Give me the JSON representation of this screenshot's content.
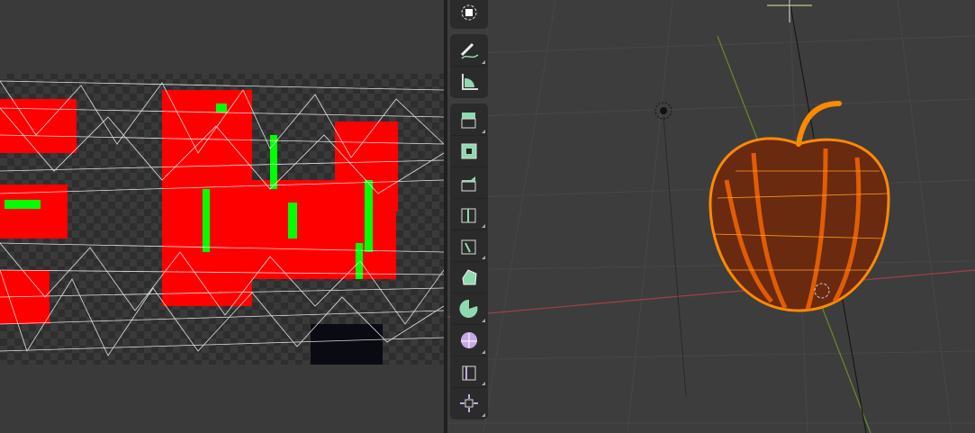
{
  "editors": {
    "left": "uv-editor",
    "right": "3d-viewport"
  },
  "colors": {
    "accent_selection": "#ff8a00",
    "axis_x": "#a0404a",
    "axis_y": "#6b8a2a",
    "tool_green": "#8fd9b0",
    "tool_purple": "#c7a8e6"
  },
  "toolbar": {
    "tools": [
      {
        "name": "transform",
        "icon": "transform-icon"
      },
      {
        "name": "annotate",
        "icon": "annotate-icon"
      },
      {
        "name": "measure",
        "icon": "measure-icon"
      },
      {
        "name": "extrude-region",
        "icon": "extrude-region-icon"
      },
      {
        "name": "inset-faces",
        "icon": "inset-faces-icon"
      },
      {
        "name": "bevel",
        "icon": "bevel-icon"
      },
      {
        "name": "loop-cut",
        "icon": "loop-cut-icon"
      },
      {
        "name": "knife",
        "icon": "knife-icon"
      },
      {
        "name": "poly-build",
        "icon": "poly-build-icon"
      },
      {
        "name": "spin",
        "icon": "spin-icon"
      },
      {
        "name": "smooth",
        "icon": "smooth-icon"
      },
      {
        "name": "edge-slide",
        "icon": "edge-slide-icon"
      },
      {
        "name": "shrink-fatten",
        "icon": "shrink-fatten-icon"
      }
    ]
  }
}
